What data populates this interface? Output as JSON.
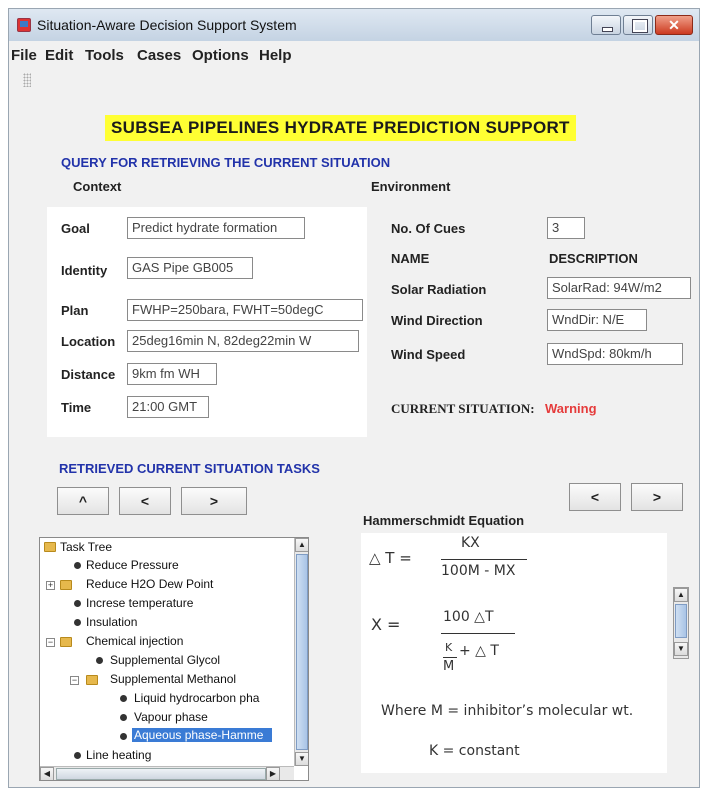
{
  "window": {
    "title": "Situation-Aware Decision Support System",
    "close_glyph": "✕"
  },
  "menu": [
    "File",
    "Edit",
    "Tools",
    "Cases",
    "Options",
    "Help"
  ],
  "headline": "SUBSEA PIPELINES HYDRATE PREDICTION SUPPORT",
  "query_title": "QUERY FOR RETRIEVING THE CURRENT SITUATION",
  "context": {
    "title": "Context",
    "fields": [
      {
        "label": "Goal",
        "value": "Predict hydrate formation"
      },
      {
        "label": "Identity",
        "value": "GAS Pipe GB005"
      },
      {
        "label": "Plan",
        "value": "FWHP=250bara, FWHT=50degC"
      },
      {
        "label": "Location",
        "value": "25deg16min N, 82deg22min W"
      },
      {
        "label": "Distance",
        "value": "9km fm WH"
      },
      {
        "label": "Time",
        "value": "21:00 GMT"
      }
    ]
  },
  "environment": {
    "title": "Environment",
    "cues_label": "No. Of Cues",
    "cues_value": "3",
    "name_header": "NAME",
    "description_header": "DESCRIPTION",
    "cues": [
      {
        "name": "Solar Radiation",
        "description": "SolarRad: 94W/m2"
      },
      {
        "name": "Wind Direction",
        "description": "WndDir: N/E"
      },
      {
        "name": "Wind Speed",
        "description": "WndSpd: 80km/h"
      }
    ],
    "situation_label": "CURRENT SITUATION:",
    "situation_value": "Warning",
    "situation_color": "#e53b3b"
  },
  "tasks_title": "RETRIEVED CURRENT SITUATION TASKS",
  "tasks_nav": {
    "up": "^",
    "prev": "<",
    "next": ">"
  },
  "equation_nav": {
    "prev": "<",
    "next": ">"
  },
  "equation_title": "Hammerschmidt Equation",
  "tree": {
    "nodes": [
      {
        "label": "Task Tree",
        "icon": "folder-icon"
      },
      {
        "label": "Reduce Pressure",
        "icon": "bullet-icon"
      },
      {
        "label": "Reduce H2O Dew Point",
        "icon": "folder-icon"
      },
      {
        "label": "Increse temperature",
        "icon": "bullet-icon"
      },
      {
        "label": "Insulation",
        "icon": "bullet-icon"
      },
      {
        "label": "Chemical injection",
        "icon": "folder-icon"
      },
      {
        "label": "Supplemental Glycol",
        "icon": "bullet-icon"
      },
      {
        "label": "Supplemental Methanol",
        "icon": "folder-icon"
      },
      {
        "label": "Liquid hydrocarbon pha",
        "icon": "bullet-icon"
      },
      {
        "label": "Vapour phase",
        "icon": "bullet-icon"
      },
      {
        "label": "Aqueous phase-Hamme",
        "icon": "bullet-icon",
        "selected": true
      },
      {
        "label": "Line heating",
        "icon": "bullet-icon"
      }
    ],
    "selection_color": "#3a7bd5"
  },
  "equation": {
    "delta_t": "△ T =",
    "num1": "KX",
    "den1": "100M - MX",
    "x_eq": "X  =",
    "num2": "100 △T",
    "den2_k": "K",
    "den2_plus": "+ △  T",
    "den2_m": "M",
    "where": "Where M = inhibitor’s molecular wt.",
    "k_const": "K = constant"
  }
}
